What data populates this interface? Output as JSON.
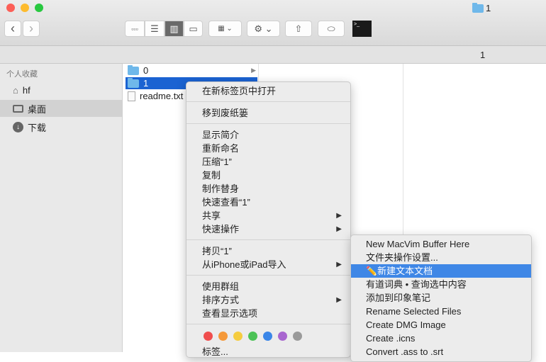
{
  "window": {
    "title": "1",
    "path_label": "1"
  },
  "toolbar": {
    "back": "‹",
    "forward": "›"
  },
  "sidebar": {
    "section": "个人收藏",
    "items": [
      {
        "label": "hf",
        "icon": "home-icon"
      },
      {
        "label": "桌面",
        "icon": "desktop-icon",
        "selected": true
      },
      {
        "label": "下载",
        "icon": "download-icon"
      }
    ]
  },
  "column1": {
    "items": [
      {
        "name": "0",
        "type": "folder"
      },
      {
        "name": "1",
        "type": "folder",
        "selected": true
      },
      {
        "name": "readme.txt",
        "type": "file"
      }
    ]
  },
  "context_menu": {
    "groups": [
      [
        "在新标签页中打开"
      ],
      [
        "移到废纸篓"
      ],
      [
        "显示简介",
        "重新命名",
        "压缩“1”",
        "复制",
        "制作替身",
        "快速查看“1”",
        "共享",
        "快速操作"
      ],
      [
        "拷贝“1”",
        "从iPhone或iPad导入"
      ],
      [
        "使用群组",
        "排序方式",
        "查看显示选项"
      ]
    ],
    "tags_label": "标签...",
    "tag_colors": [
      "#f04e4e",
      "#f5993a",
      "#f5cc3f",
      "#4cc256",
      "#3b86e8",
      "#a866cf",
      "#9a9a9a"
    ]
  },
  "submenu": {
    "items": [
      "New MacVim Buffer Here",
      "文件夹操作设置...",
      "✏️新建文本文档",
      "有道词典 • 查询选中内容",
      "添加到印象笔记",
      "Rename Selected Files",
      "Create DMG Image",
      "Create .icns",
      "Convert .ass to .srt"
    ],
    "highlighted": 2
  },
  "colors": {
    "accent": "#3f87e6"
  }
}
